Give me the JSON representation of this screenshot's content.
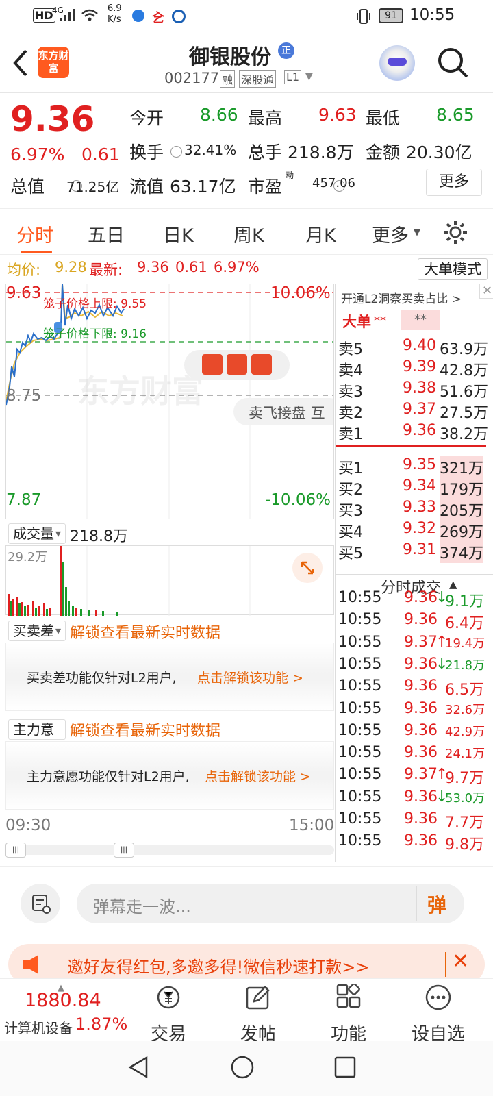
{
  "statusbar": {
    "hd": "HD",
    "net": "4G",
    "speed": "6.9 K/s",
    "battery": "91",
    "time": "10:55"
  },
  "header": {
    "logo": "东方财富",
    "stock_name": "御银股份",
    "badge": "正",
    "code": "002177",
    "tags": [
      "融",
      "深股通",
      "L1"
    ]
  },
  "quote": {
    "price": "9.36",
    "pct": "6.97%",
    "change": "0.61",
    "open_label": "今开",
    "open": "8.66",
    "high_label": "最高",
    "high": "9.63",
    "low_label": "最低",
    "low": "8.65",
    "turnover_label": "换手",
    "turnover": "32.41%",
    "vol_label": "总手",
    "vol": "218.8万",
    "amt_label": "金额",
    "amt": "20.30亿",
    "mcap_label": "总值",
    "mcap": "71.25亿",
    "float_label": "流值",
    "float": "63.17亿",
    "pe_label": "市盈",
    "pe_sup": "动",
    "pe": "457.06",
    "more": "更多"
  },
  "tabs": [
    "分时",
    "五日",
    "日K",
    "周K",
    "月K",
    "更多"
  ],
  "avg": {
    "avg_label": "均价:",
    "avg": "9.28",
    "last_label": "最新:",
    "last": "9.36",
    "chg": "0.61",
    "pct": "6.97%",
    "big_mode": "大单模式"
  },
  "chart": {
    "top": "9.63",
    "top_pct": "10.06%",
    "mid": "8.75",
    "bottom": "7.87",
    "bottom_pct": "-10.06%",
    "upper_limit": "笼子价格上限: 9.55",
    "lower_limit": "笼子价格下限: 9.16",
    "watermark": "东方财富",
    "sell_ad": "卖飞接盘 互",
    "vol_select": "成交量",
    "vol_total": "218.8万",
    "vol_max": "29.2万",
    "time_start": "09:30",
    "time_end": "15:00"
  },
  "panels": {
    "bs_select": "买卖差",
    "bs_unlock": "解锁查看最新实时数据",
    "bs_text": "买卖差功能仅针对L2用户,",
    "bs_link": "点击解锁该功能 >",
    "mf_select": "主力意愿",
    "mf_unlock": "解锁查看最新实时数据",
    "mf_text": "主力意愿功能仅针对L2用户,",
    "mf_link": "点击解锁该功能 >"
  },
  "orderbook": {
    "l2_tip": "开通L2洞察买卖占比 >",
    "big_label": "大单",
    "big_a": "**",
    "big_b": "**",
    "sells": [
      {
        "l": "卖5",
        "p": "9.40",
        "v": "63.9万"
      },
      {
        "l": "卖4",
        "p": "9.39",
        "v": "42.8万"
      },
      {
        "l": "卖3",
        "p": "9.38",
        "v": "51.6万"
      },
      {
        "l": "卖2",
        "p": "9.37",
        "v": "27.5万"
      },
      {
        "l": "卖1",
        "p": "9.36",
        "v": "38.2万"
      }
    ],
    "buys": [
      {
        "l": "买1",
        "p": "9.35",
        "v": "321万"
      },
      {
        "l": "买2",
        "p": "9.34",
        "v": "179万"
      },
      {
        "l": "买3",
        "p": "9.33",
        "v": "205万"
      },
      {
        "l": "买4",
        "p": "9.32",
        "v": "269万"
      },
      {
        "l": "买5",
        "p": "9.31",
        "v": "374万"
      }
    ],
    "ticks_title": "分时成交",
    "ticks": [
      {
        "t": "10:55",
        "p": "9.36",
        "d": "↓",
        "v": "9.1万"
      },
      {
        "t": "10:55",
        "p": "9.36",
        "d": "",
        "v": "6.4万"
      },
      {
        "t": "10:55",
        "p": "9.37",
        "d": "↑",
        "v": "19.4万"
      },
      {
        "t": "10:55",
        "p": "9.36",
        "d": "↓",
        "v": "21.8万"
      },
      {
        "t": "10:55",
        "p": "9.36",
        "d": "",
        "v": "6.5万"
      },
      {
        "t": "10:55",
        "p": "9.36",
        "d": "",
        "v": "32.6万"
      },
      {
        "t": "10:55",
        "p": "9.36",
        "d": "",
        "v": "42.9万"
      },
      {
        "t": "10:55",
        "p": "9.36",
        "d": "",
        "v": "24.1万"
      },
      {
        "t": "10:55",
        "p": "9.37",
        "d": "↑",
        "v": "9.7万"
      },
      {
        "t": "10:55",
        "p": "9.36",
        "d": "↓",
        "v": "53.0万"
      },
      {
        "t": "10:55",
        "p": "9.36",
        "d": "",
        "v": "7.7万"
      },
      {
        "t": "10:55",
        "p": "9.36",
        "d": "",
        "v": "9.8万"
      }
    ]
  },
  "comment": {
    "placeholder": "弹幕走一波...",
    "send": "弹"
  },
  "banner": {
    "text": "邀好友得红包,多邀多得!微信秒速打款>>"
  },
  "bottom": {
    "index_value": "1880.84",
    "index_name": "计算机设备",
    "index_pct": "1.87%",
    "trade": "交易",
    "post": "发帖",
    "func": "功能",
    "watch": "设自选"
  }
}
